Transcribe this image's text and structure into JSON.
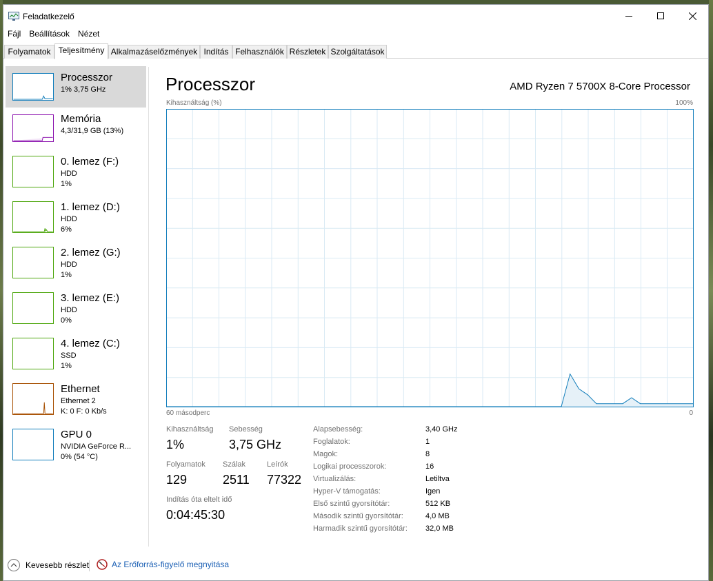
{
  "window": {
    "title": "Feladatkezelő"
  },
  "menu": [
    "Fájl",
    "Beállítások",
    "Nézet"
  ],
  "tabs": [
    "Folyamatok",
    "Teljesítmény",
    "Alkalmazáselőzmények",
    "Indítás",
    "Felhasználók",
    "Részletek",
    "Szolgáltatások"
  ],
  "active_tab": "Teljesítmény",
  "sidebar": [
    {
      "name": "Processzor",
      "sub1": "1% 3,75 GHz",
      "sub2": "",
      "color": "#117dbb"
    },
    {
      "name": "Memória",
      "sub1": "4,3/31,9 GB (13%)",
      "sub2": "",
      "color": "#8b12ae"
    },
    {
      "name": "0. lemez (F:)",
      "sub1": "HDD",
      "sub2": "1%",
      "color": "#4da60c"
    },
    {
      "name": "1. lemez (D:)",
      "sub1": "HDD",
      "sub2": "6%",
      "color": "#4da60c"
    },
    {
      "name": "2. lemez (G:)",
      "sub1": "HDD",
      "sub2": "1%",
      "color": "#4da60c"
    },
    {
      "name": "3. lemez (E:)",
      "sub1": "HDD",
      "sub2": "0%",
      "color": "#4da60c"
    },
    {
      "name": "4. lemez (C:)",
      "sub1": "SSD",
      "sub2": "1%",
      "color": "#4da60c"
    },
    {
      "name": "Ethernet",
      "sub1": "Ethernet 2",
      "sub2": "K: 0 F: 0 Kb/s",
      "color": "#a74f01"
    },
    {
      "name": "GPU 0",
      "sub1": "NVIDIA GeForce R...",
      "sub2": "0% (54 °C)",
      "color": "#117dbb"
    }
  ],
  "main": {
    "title": "Processzor",
    "cpu_model": "AMD Ryzen 7 5700X 8-Core Processor",
    "graph_label": "Kihasználtság (%)",
    "graph_max": "100%",
    "graph_time": "60 másodperc",
    "graph_min": "0"
  },
  "stats": {
    "util_label": "Kihasználtság",
    "util_value": "1%",
    "speed_label": "Sebesség",
    "speed_value": "3,75 GHz",
    "proc_label": "Folyamatok",
    "proc_value": "129",
    "threads_label": "Szálak",
    "threads_value": "2511",
    "handles_label": "Leírók",
    "handles_value": "77322",
    "uptime_label": "Indítás óta eltelt idő",
    "uptime_value": "0:04:45:30"
  },
  "specs": [
    {
      "label": "Alapsebesség:",
      "value": "3,40 GHz"
    },
    {
      "label": "Foglalatok:",
      "value": "1"
    },
    {
      "label": "Magok:",
      "value": "8"
    },
    {
      "label": "Logikai processzorok:",
      "value": "16"
    },
    {
      "label": "Virtualizálás:",
      "value": "Letiltva"
    },
    {
      "label": "Hyper-V támogatás:",
      "value": "Igen"
    },
    {
      "label": "Első szintű gyorsítótár:",
      "value": "512 KB"
    },
    {
      "label": "Második szintű gyorsítótár:",
      "value": "4,0 MB"
    },
    {
      "label": "Harmadik szintű gyorsítótár:",
      "value": "32,0 MB"
    }
  ],
  "footer": {
    "fewer_details": "Kevesebb részlet",
    "resource_monitor": "Az Erőforrás-figyelő megnyitása"
  },
  "cpu_history": {
    "seconds": [
      60,
      59,
      58,
      57,
      56,
      55,
      54,
      53,
      52,
      51,
      50,
      49,
      48,
      47,
      46,
      45,
      44,
      43,
      42,
      41,
      40,
      39,
      38,
      37,
      36,
      35,
      34,
      33,
      32,
      31,
      30,
      29,
      28,
      27,
      26,
      25,
      24,
      23,
      22,
      21,
      20,
      19,
      18,
      17,
      16,
      15,
      14,
      13,
      12,
      11,
      10,
      9,
      8,
      7,
      6,
      5,
      4,
      3,
      2,
      1,
      0
    ],
    "values": [
      0,
      0,
      0,
      0,
      0,
      0,
      0,
      0,
      0,
      0,
      0,
      0,
      0,
      0,
      0,
      0,
      0,
      0,
      0,
      0,
      0,
      0,
      0,
      0,
      0,
      0,
      0,
      0,
      0,
      0,
      0,
      0,
      0,
      0,
      0,
      0,
      0,
      0,
      0,
      0,
      0,
      0,
      0,
      0,
      0,
      0,
      11,
      6,
      4,
      1,
      1,
      1,
      1,
      3,
      1,
      1,
      1,
      1,
      1,
      1,
      1
    ]
  }
}
